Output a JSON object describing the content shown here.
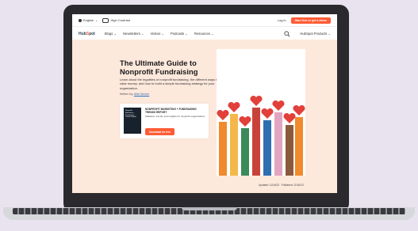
{
  "utility_bar": {
    "language": "English",
    "high_contrast": "High Contrast",
    "login": "Log in",
    "cta": "Start free or get a demo"
  },
  "nav": {
    "logo_prefix": "Hub",
    "logo_o": "S",
    "logo_suffix": "pot",
    "items": [
      {
        "label": "Blogs ⌄"
      },
      {
        "label": "Newsletters ⌄"
      },
      {
        "label": "Videos ⌄"
      },
      {
        "label": "Podcasts ⌄"
      },
      {
        "label": "Resources ⌄"
      }
    ],
    "products": "HubSpot Products ⌄"
  },
  "hero": {
    "title": "The Ultimate Guide to Nonprofit Fundraising",
    "description": "Learn about the legalities of nonprofit fundraising, the different ways to raise money, and how to build a simple fundraising strategy for your organization.",
    "written_by": "Written by:",
    "author": "Allie Decker",
    "updated": "Updated: 11/16/23",
    "published": "Published: 11/16/23"
  },
  "offer_card": {
    "book_text": "Nonprofit Marketing + Fundraising Trends Report",
    "title": "NONPROFIT MARKETING + FUNDRAISING TRENDS REPORT",
    "subtitle": "Statistics, trends, and insights for nonprofit organizations",
    "button": "Download for free"
  },
  "illustration": {
    "hand_colors": [
      "#f08a2c",
      "#f4b84a",
      "#3b8a5a",
      "#c9423a",
      "#2e6fb0",
      "#e3a4c2",
      "#8a5a3c"
    ],
    "heart_color": "#e2403a"
  }
}
